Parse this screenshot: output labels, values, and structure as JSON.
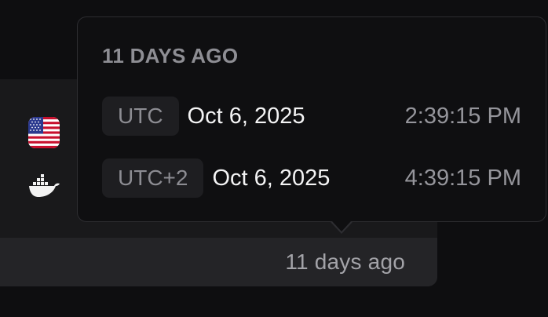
{
  "card": {
    "relative_time": "11 days ago"
  },
  "icons": {
    "flag": "us-flag-icon",
    "docker": "docker-icon"
  },
  "tooltip": {
    "title": "11 DAYS AGO",
    "rows": [
      {
        "tz": "UTC",
        "date": "Oct 6, 2025",
        "time": "2:39:15 PM"
      },
      {
        "tz": "UTC+2",
        "date": "Oct 6, 2025",
        "time": "4:39:15 PM"
      }
    ]
  },
  "colors": {
    "background": "#0e0e10",
    "card": "#19191b",
    "card_footer": "#242427",
    "tooltip_bg": "#0f0f11",
    "tooltip_border": "#2d2d31",
    "badge_bg": "#1e1e21"
  }
}
